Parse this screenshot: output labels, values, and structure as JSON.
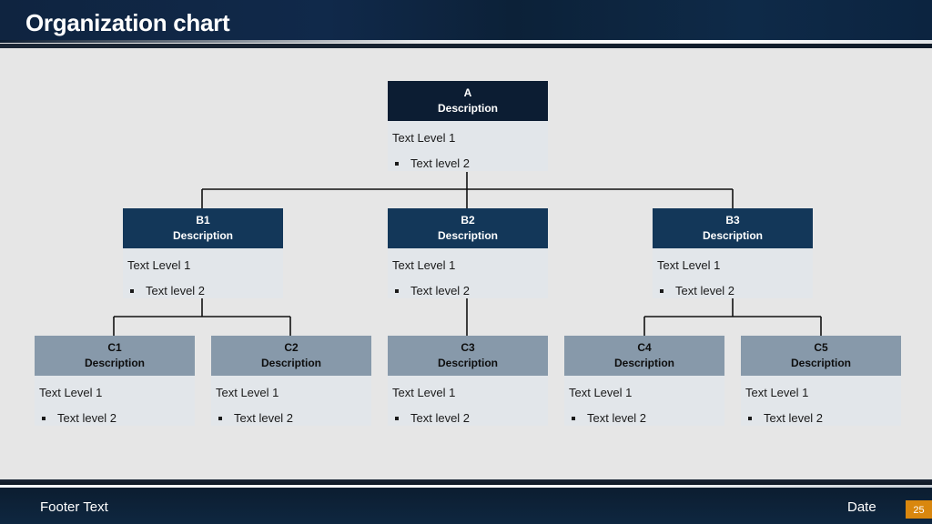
{
  "slide": {
    "title": "Organization chart",
    "footer_text": "Footer Text",
    "date": "Date",
    "page_number": "25"
  },
  "colors": {
    "level_a_header": "#0c1d33",
    "level_b_header": "#133759",
    "level_c_header": "#8799aa",
    "page_number_badge": "#d9870e"
  },
  "chart": {
    "nodes": {
      "A": {
        "name": "A",
        "description": "Description",
        "text_level_1": "Text Level 1",
        "text_level_2": "Text level 2",
        "parent": null
      },
      "B1": {
        "name": "B1",
        "description": "Description",
        "text_level_1": "Text Level 1",
        "text_level_2": "Text level 2",
        "parent": "A"
      },
      "B2": {
        "name": "B2",
        "description": "Description",
        "text_level_1": "Text Level 1",
        "text_level_2": "Text level 2",
        "parent": "A"
      },
      "B3": {
        "name": "B3",
        "description": "Description",
        "text_level_1": "Text Level 1",
        "text_level_2": "Text level 2",
        "parent": "A"
      },
      "C1": {
        "name": "C1",
        "description": "Description",
        "text_level_1": "Text Level 1",
        "text_level_2": "Text level 2",
        "parent": "B1"
      },
      "C2": {
        "name": "C2",
        "description": "Description",
        "text_level_1": "Text Level 1",
        "text_level_2": "Text level 2",
        "parent": "B1"
      },
      "C3": {
        "name": "C3",
        "description": "Description",
        "text_level_1": "Text Level 1",
        "text_level_2": "Text level 2",
        "parent": "B2"
      },
      "C4": {
        "name": "C4",
        "description": "Description",
        "text_level_1": "Text Level 1",
        "text_level_2": "Text level 2",
        "parent": "B3"
      },
      "C5": {
        "name": "C5",
        "description": "Description",
        "text_level_1": "Text Level 1",
        "text_level_2": "Text level 2",
        "parent": "B3"
      }
    }
  }
}
